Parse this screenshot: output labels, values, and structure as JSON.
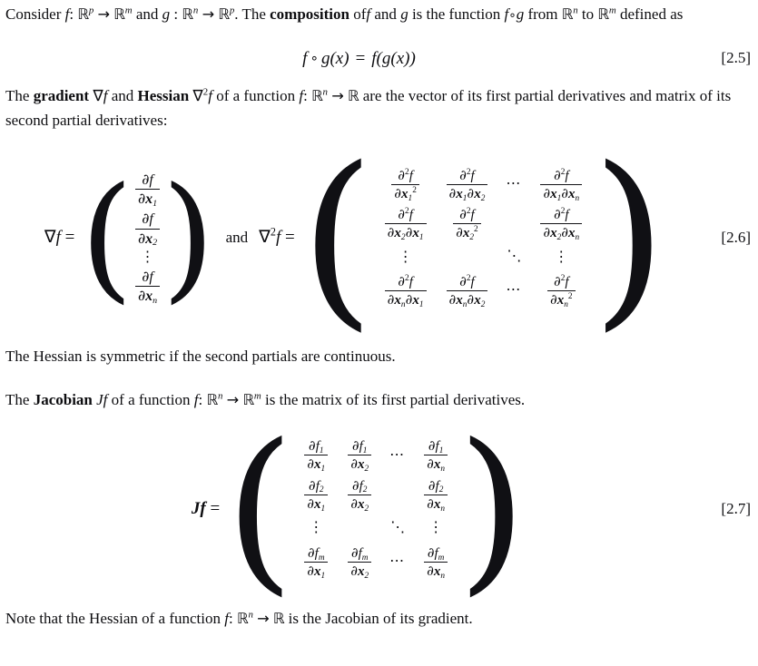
{
  "document": {
    "paragraphs": {
      "p1_before_composition": "Consider f : ℝᵖ → ℝᵐ and g : ℝⁿ → ℝᵖ. The ",
      "p1_bold": "composition",
      "p1_after": " of f and g is the function f ∘ g from ℝⁿ to ℝᵐ defined as",
      "p2_bold_1": "gradient",
      "p2_bold_2": "Hessian",
      "p2_text": "The gradient ∇f and Hessian ∇²f of a function f : ℝⁿ → ℝ are the vector of its first partial derivatives and matrix of its second partial derivatives:",
      "p3": "The Hessian is symmetric if the second partials are continuous.",
      "p4_bold": "Jacobian",
      "p4_text": "The Jacobian Jf of a function f : ℝⁿ → ℝᵐ is the matrix of its first partial derivatives.",
      "p5": "Note that the Hessian of a function f : ℝⁿ → ℝ is the Jacobian of its gradient."
    },
    "symbols": {
      "consider": "Consider",
      "colon": ":",
      "arrow": "→",
      "and": "and",
      "period": ".",
      "the": "The",
      "of": "of",
      "is_the_function": "is the function",
      "ring": "∘",
      "from": "from",
      "to": "to",
      "defined_as": "defined as",
      "f": "f",
      "g": "g",
      "x": "x",
      "R": "ℝ",
      "sup_p": "p",
      "sup_m": "m",
      "sup_n": "n",
      "nabla": "∇",
      "nabla_sq_pre": "∇",
      "sup_2": "2",
      "equals": "=",
      "conj_and": "and",
      "Jf": "Jf",
      "partial": "∂",
      "ldots": "⋯",
      "vdots": "⋮",
      "ddots": "⋱",
      "lparen": "(",
      "rparen": ")"
    },
    "equations": {
      "eq25": {
        "number": "[2.5]",
        "lhs": "f ∘ g(x)",
        "rhs": "f(g(x))",
        "parts": {
          "f": "f",
          "ring": "∘",
          "g": "g",
          "open": "(",
          "x": "x",
          "close": ")",
          "equals": "=",
          "rhs_full": "f(g(x))"
        }
      },
      "eq26": {
        "number": "[2.6]",
        "gradient_label": "∇f",
        "conjunction": "and",
        "hessian_label": "∇²f",
        "gradient_entries": [
          {
            "num": "∂f",
            "den_partial": "∂",
            "den_var": "x",
            "den_sub": "1"
          },
          {
            "num": "∂f",
            "den_partial": "∂",
            "den_var": "x",
            "den_sub": "2"
          },
          {
            "vdots": "⋮"
          },
          {
            "num": "∂f",
            "den_partial": "∂",
            "den_var": "x",
            "den_sub": "n"
          }
        ],
        "hessian_rows": [
          [
            {
              "num_partial": "∂",
              "num_sup": "2",
              "num_f": "f",
              "den": "∂x₁²",
              "den_parts": {
                "p1": "∂",
                "v1": "x",
                "s1": "1",
                "sup": "2"
              }
            },
            {
              "num_partial": "∂",
              "num_sup": "2",
              "num_f": "f",
              "den": "∂x₁∂x₂",
              "den_parts": {
                "p1": "∂",
                "v1": "x",
                "s1": "1",
                "p2": "∂",
                "v2": "x",
                "s2": "2"
              }
            },
            {
              "dots": "⋯"
            },
            {
              "num_partial": "∂",
              "num_sup": "2",
              "num_f": "f",
              "den": "∂x₁∂xₙ",
              "den_parts": {
                "p1": "∂",
                "v1": "x",
                "s1": "1",
                "p2": "∂",
                "v2": "x",
                "s2": "n"
              }
            }
          ],
          [
            {
              "num_partial": "∂",
              "num_sup": "2",
              "num_f": "f",
              "den": "∂x₂∂x₁",
              "den_parts": {
                "p1": "∂",
                "v1": "x",
                "s1": "2",
                "p2": "∂",
                "v2": "x",
                "s2": "1"
              }
            },
            {
              "num_partial": "∂",
              "num_sup": "2",
              "num_f": "f",
              "den": "∂x₂²",
              "den_parts": {
                "p1": "∂",
                "v1": "x",
                "s1": "2",
                "sup": "2"
              }
            },
            {
              "empty": ""
            },
            {
              "num_partial": "∂",
              "num_sup": "2",
              "num_f": "f",
              "den": "∂x₂∂xₙ",
              "den_parts": {
                "p1": "∂",
                "v1": "x",
                "s1": "2",
                "p2": "∂",
                "v2": "x",
                "s2": "n"
              }
            }
          ],
          [
            {
              "vdots": "⋮"
            },
            {
              "empty": ""
            },
            {
              "ddots": "⋱"
            },
            {
              "vdots": "⋮"
            }
          ],
          [
            {
              "num_partial": "∂",
              "num_sup": "2",
              "num_f": "f",
              "den": "∂xₙ∂x₁",
              "den_parts": {
                "p1": "∂",
                "v1": "x",
                "s1": "n",
                "p2": "∂",
                "v2": "x",
                "s2": "1"
              }
            },
            {
              "num_partial": "∂",
              "num_sup": "2",
              "num_f": "f",
              "den": "∂xₙ∂x₂",
              "den_parts": {
                "p1": "∂",
                "v1": "x",
                "s1": "n",
                "p2": "∂",
                "v2": "x",
                "s2": "2"
              }
            },
            {
              "dots": "⋯"
            },
            {
              "num_partial": "∂",
              "num_sup": "2",
              "num_f": "f",
              "den": "∂xₙ²",
              "den_parts": {
                "p1": "∂",
                "v1": "x",
                "s1": "n",
                "sup": "2"
              }
            }
          ]
        ]
      },
      "eq27": {
        "number": "[2.7]",
        "label": "Jf",
        "rows": [
          [
            {
              "num_f": "f",
              "num_sub": "1",
              "den_var": "x",
              "den_sub": "1"
            },
            {
              "num_f": "f",
              "num_sub": "1",
              "den_var": "x",
              "den_sub": "2"
            },
            {
              "dots": "⋯"
            },
            {
              "num_f": "f",
              "num_sub": "1",
              "den_var": "x",
              "den_sub": "n"
            }
          ],
          [
            {
              "num_f": "f",
              "num_sub": "2",
              "den_var": "x",
              "den_sub": "1"
            },
            {
              "num_f": "f",
              "num_sub": "2",
              "den_var": "x",
              "den_sub": "2"
            },
            {
              "empty": ""
            },
            {
              "num_f": "f",
              "num_sub": "2",
              "den_var": "x",
              "den_sub": "n"
            }
          ],
          [
            {
              "vdots": "⋮"
            },
            {
              "empty": ""
            },
            {
              "ddots": "⋱"
            },
            {
              "vdots": "⋮"
            }
          ],
          [
            {
              "num_f": "f",
              "num_sub": "m",
              "den_var": "x",
              "den_sub": "1"
            },
            {
              "num_f": "f",
              "num_sub": "m",
              "den_var": "x",
              "den_sub": "2"
            },
            {
              "dots": "⋯"
            },
            {
              "num_f": "f",
              "num_sub": "m",
              "den_var": "x",
              "den_sub": "n"
            }
          ]
        ]
      }
    }
  }
}
